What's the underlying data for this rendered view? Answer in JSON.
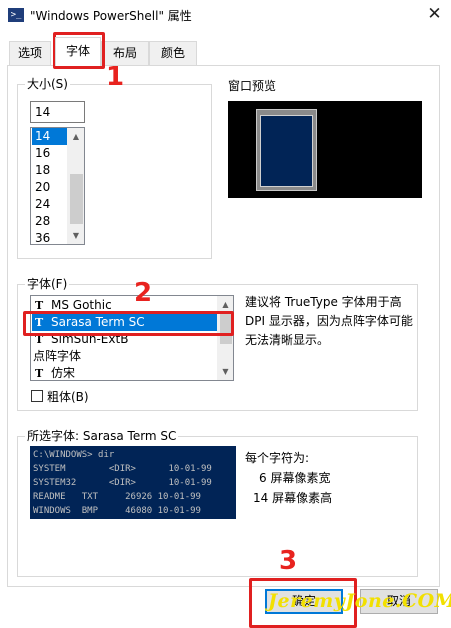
{
  "window": {
    "title": "\"Windows PowerShell\" 属性",
    "close_glyph": "✕",
    "icon_glyph": ">_"
  },
  "tabs": [
    {
      "label": "选项"
    },
    {
      "label": "字体"
    },
    {
      "label": "布局"
    },
    {
      "label": "颜色"
    }
  ],
  "size": {
    "group_label": "大小(S)",
    "value": "14",
    "options": [
      "14",
      "16",
      "18",
      "20",
      "24",
      "28",
      "36"
    ],
    "selected": "14"
  },
  "preview": {
    "label": "窗口预览"
  },
  "font": {
    "group_label": "字体(F)",
    "options": [
      {
        "label": "MS Gothic",
        "icon": "truetype-icon"
      },
      {
        "label": "Sarasa Term SC",
        "icon": "truetype-icon"
      },
      {
        "label": "SimSun-ExtB",
        "icon": "truetype-icon"
      },
      {
        "label": "点阵字体",
        "icon": ""
      },
      {
        "label": "仿宋",
        "icon": "truetype-icon"
      }
    ],
    "selected": "Sarasa Term SC",
    "tt_glyph": "T",
    "description": "建议将 TrueType 字体用于高 DPI 显示器，因为点阵字体可能无法清晰显示。",
    "bold_label": "粗体(B)",
    "bold_checked": false
  },
  "selected_font": {
    "group_label": "所选字体: Sarasa Term SC",
    "sample_lines": [
      "C:\\WINDOWS> dir",
      "SYSTEM        <DIR>      10-01-99",
      "SYSTEM32      <DIR>      10-01-99",
      "README   TXT     26926 10-01-99",
      "WINDOWS  BMP     46080 10-01-99"
    ],
    "char_info_title": "每个字符为:",
    "width_text": "6 屏幕像素宽",
    "height_text": "14 屏幕像素高"
  },
  "buttons": {
    "ok": "确定",
    "cancel": "取消"
  },
  "annotations": {
    "step1": "1",
    "step2": "2",
    "step3": "3",
    "color": "#e02020"
  },
  "watermark": "JeremyJone.COM",
  "colors": {
    "accent": "#0078d7",
    "console_bg": "#012456"
  }
}
